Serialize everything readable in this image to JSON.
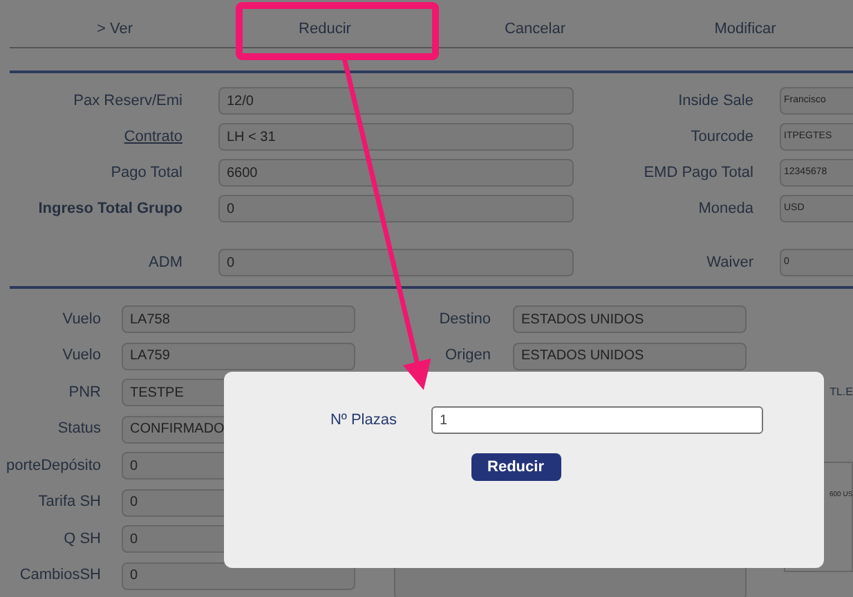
{
  "menu": [
    {
      "label": "> Ver",
      "selected": false
    },
    {
      "label": "Reducir",
      "selected": false
    },
    {
      "label": "Cancelar",
      "selected": false
    },
    {
      "label": "Modificar",
      "selected": false
    }
  ],
  "summary": {
    "rows": [
      {
        "label": "Pax Reserv/Emi",
        "kind": "plain",
        "value": "12/0",
        "right_label": "Inside Sale",
        "right_value": "Francisco"
      },
      {
        "label": "Contrato",
        "kind": "link",
        "value": "LH < 31",
        "right_label": "Tourcode",
        "right_value": "ITPEGTES"
      },
      {
        "label": "Pago Total",
        "kind": "plain",
        "value": "6600",
        "right_label": "EMD Pago Total",
        "right_value": "12345678"
      },
      {
        "label": "Ingreso Total Grupo",
        "kind": "bold",
        "value": "0",
        "right_label": "Moneda",
        "right_value": "USD"
      },
      {
        "label": "ADM",
        "kind": "plain",
        "value": "0",
        "right_label": "Waiver",
        "right_value": "0"
      }
    ]
  },
  "details": {
    "rows": [
      {
        "label": "Vuelo",
        "value": "LA758"
      },
      {
        "label": "Vuelo",
        "value": "LA759"
      },
      {
        "label": "PNR",
        "value": "TESTPE"
      },
      {
        "label": "Status",
        "value": "CONFIRMADO"
      },
      {
        "label": "porteDepósito",
        "value": "0"
      },
      {
        "label": "Tarifa SH",
        "value": "0"
      },
      {
        "label": "Q SH",
        "value": "0"
      },
      {
        "label": "CambiosSH",
        "value": "0"
      }
    ],
    "middle_rows": [
      {
        "label": "Destino",
        "value": "ESTADOS UNIDOS"
      },
      {
        "label": "Origen",
        "value": "ESTADOS UNIDOS"
      }
    ],
    "right_label": "TL.E",
    "right_note": "600 US"
  },
  "dialog": {
    "field_label": "Nº Plazas",
    "field_value": "1",
    "button": "Reducir"
  }
}
